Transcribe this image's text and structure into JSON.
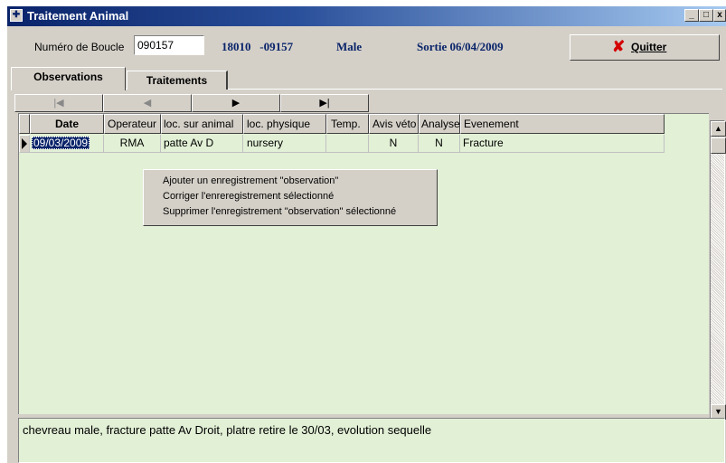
{
  "window": {
    "title": "Traitement Animal",
    "controls": {
      "minimize": "_",
      "maximize": "□",
      "close": "x"
    }
  },
  "header": {
    "boucle_label": "Numéro de Boucle",
    "boucle_value": "090157",
    "code": "18010   -09157",
    "sex": "Male",
    "sortie": "Sortie 06/04/2009",
    "quit_label": "Quitter"
  },
  "tabs": [
    {
      "label": "Observations",
      "active": true
    },
    {
      "label": "Traitements",
      "active": false
    }
  ],
  "navigator": {
    "first": "|◀",
    "prior": "◀",
    "next": "▶",
    "last": "▶|"
  },
  "grid": {
    "columns": [
      "Date",
      "Operateur",
      "loc. sur animal",
      "loc. physique",
      "Temp.",
      "Avis véto",
      "Analyse",
      "Evenement"
    ],
    "rows": [
      {
        "date": "09/03/2009",
        "operateur": "RMA",
        "loc_animal": "patte Av D",
        "loc_physique": "nursery",
        "temp": "",
        "avis_veto": "N",
        "analyse": "N",
        "evenement": "Fracture"
      }
    ]
  },
  "context_menu": {
    "items": [
      "Ajouter un enregistrement \"observation\"",
      "Corriger l'enreregistrement sélectionné",
      "Supprimer l'enregistrement \"observation\" sélectionné"
    ]
  },
  "memo": "chevreau male, fracture patte Av Droit, platre retire le 30/03, evolution sequelle",
  "colors": {
    "title_start": "#0a246a",
    "title_end": "#a6caf0",
    "grid_bg": "#e2f0d6",
    "info_text": "#0a246a",
    "quit_icon": "#d40000"
  }
}
